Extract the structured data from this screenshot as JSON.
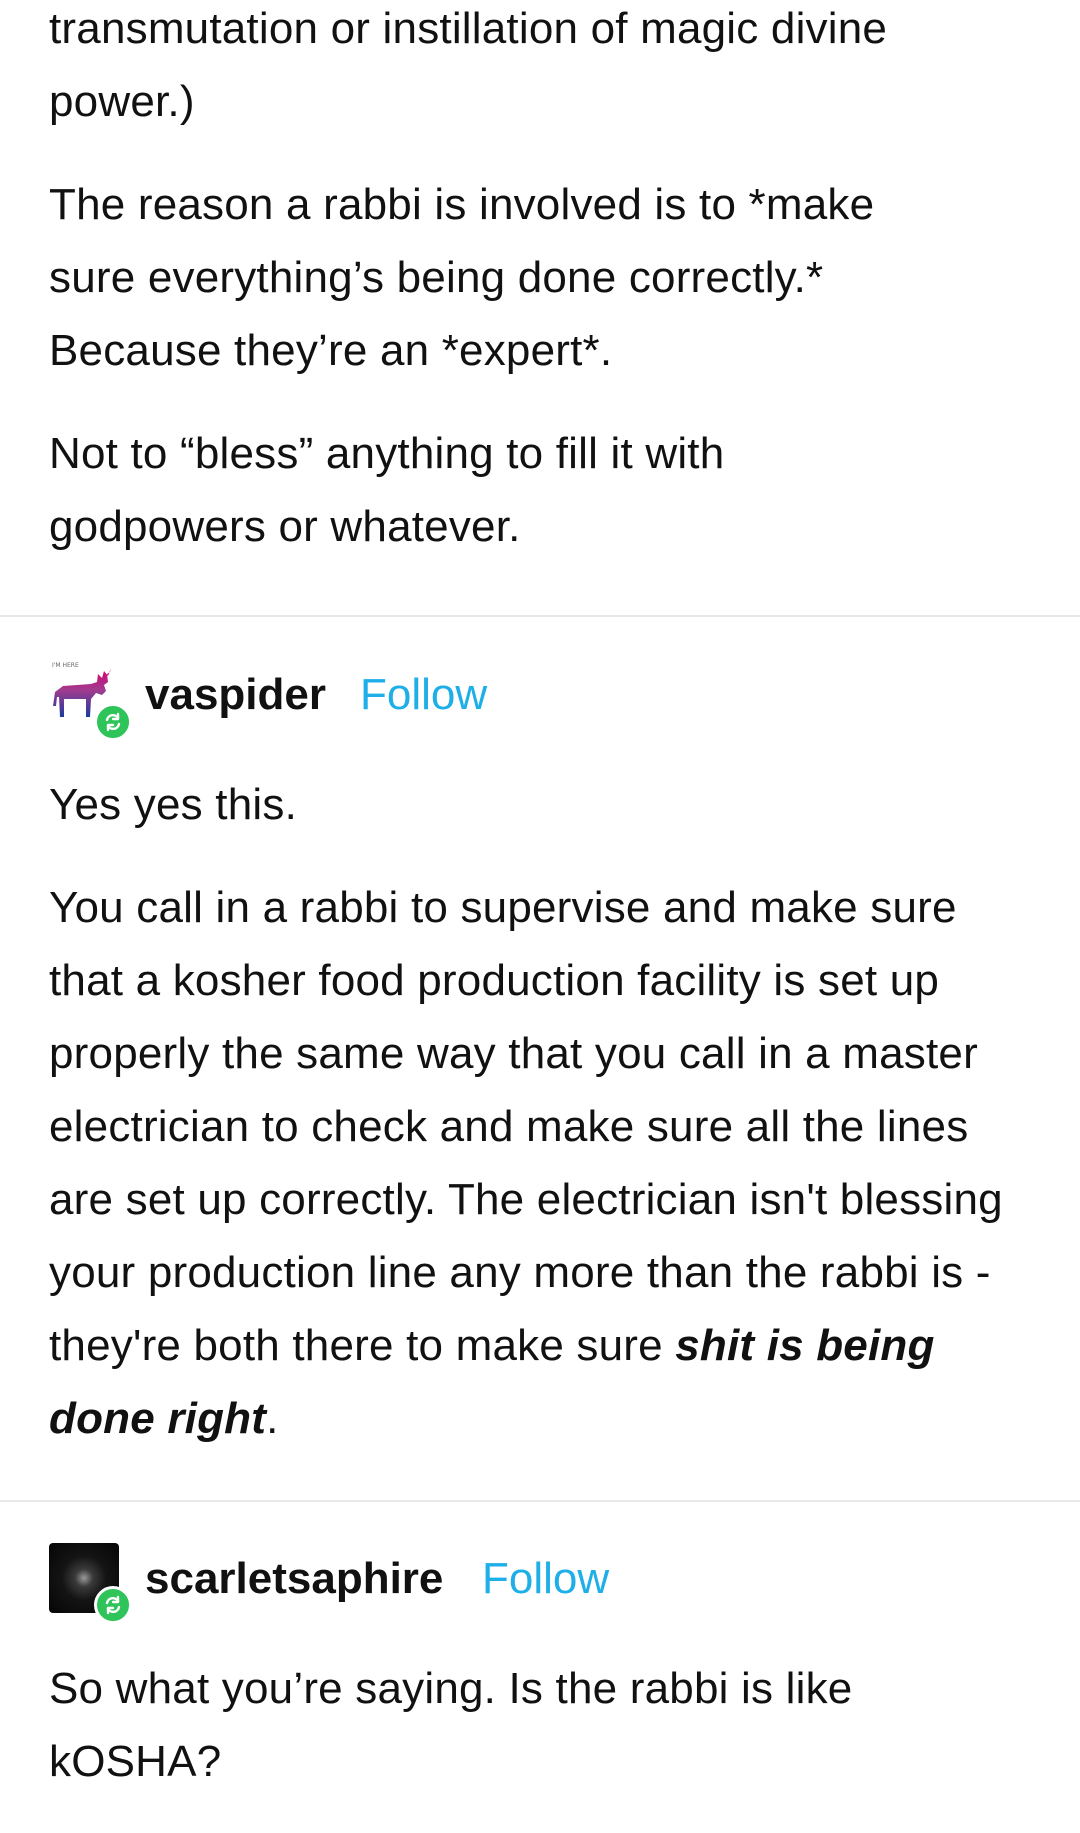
{
  "post_top": {
    "paragraph_1": "transmutation or instillation of magic divine power.)",
    "paragraph_2": "The reason a rabbi is involved is to *make sure everything’s being done correctly.* Because they’re an *expert*.",
    "paragraph_3": "Not to “bless” anything to fill it with godpowers or whatever."
  },
  "reply_1": {
    "username": "vaspider",
    "follow_label": "Follow",
    "paragraph_1": "Yes yes this.",
    "paragraph_2_text": "You call in a rabbi to supervise and make sure that a kosher food production facility is set up properly the same way that you call in a master electrician to check and make sure all the lines are set up correctly. The electrician isn't blessing your production line any more than the rabbi is - they're both there to make sure ",
    "paragraph_2_emphasis": "shit is being done right",
    "paragraph_2_end": "."
  },
  "reply_2": {
    "username": "scarletsaphire",
    "follow_label": "Follow",
    "paragraph_1": "So what you’re saying. Is the rabbi is like kOSHA?"
  },
  "colors": {
    "follow_link": "#1eaee8",
    "reblog_badge": "#2ec45a",
    "divider": "#e8e8e8"
  },
  "icons": {
    "avatar_1": "moose-avatar",
    "avatar_2": "space-avatar",
    "reblog_badge": "reblog-icon"
  }
}
